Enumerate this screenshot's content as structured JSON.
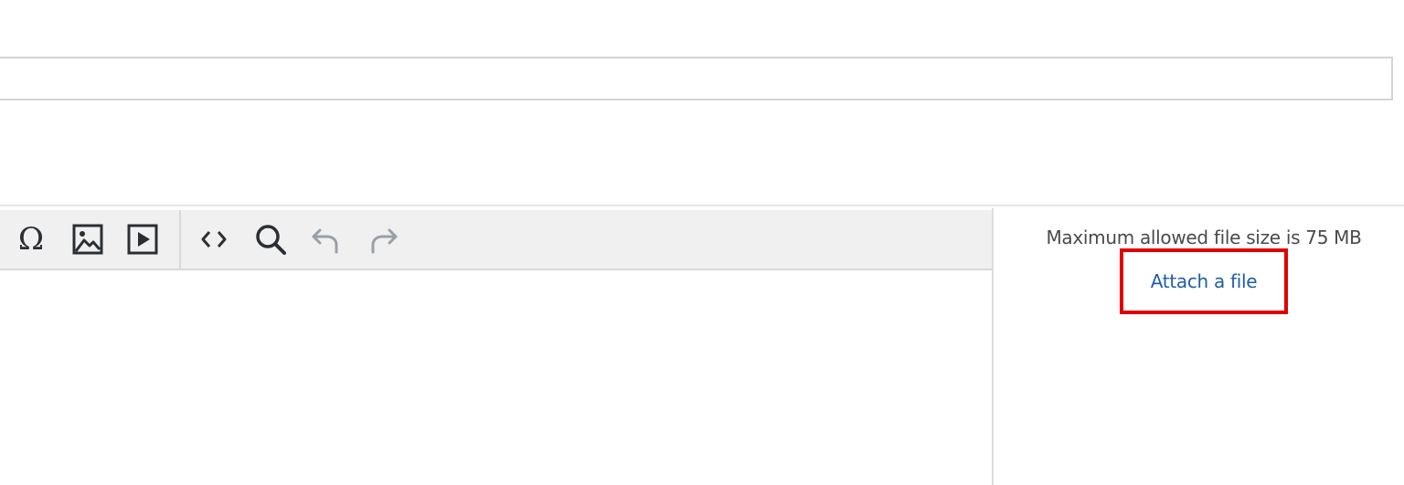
{
  "subject": {
    "value": "",
    "placeholder": ""
  },
  "toolbar": {
    "buttons": [
      {
        "name": "special-character",
        "icon": "omega-icon",
        "glyph": "Ω"
      },
      {
        "name": "insert-image",
        "icon": "image-icon"
      },
      {
        "name": "insert-media",
        "icon": "media-play-icon"
      },
      {
        "name": "source-code",
        "icon": "code-icon"
      },
      {
        "name": "find-replace",
        "icon": "search-icon"
      },
      {
        "name": "undo",
        "icon": "undo-icon"
      },
      {
        "name": "redo",
        "icon": "redo-icon"
      }
    ]
  },
  "attachments": {
    "max_size_text": "Maximum allowed file size is 75 MB",
    "attach_label": "Attach a file"
  },
  "colors": {
    "link": "#1f5ea8",
    "highlight": "#e00000",
    "toolbar_bg": "#f0f0f0",
    "icon": "#2b2f33",
    "icon_disabled": "#9aa0a6"
  }
}
